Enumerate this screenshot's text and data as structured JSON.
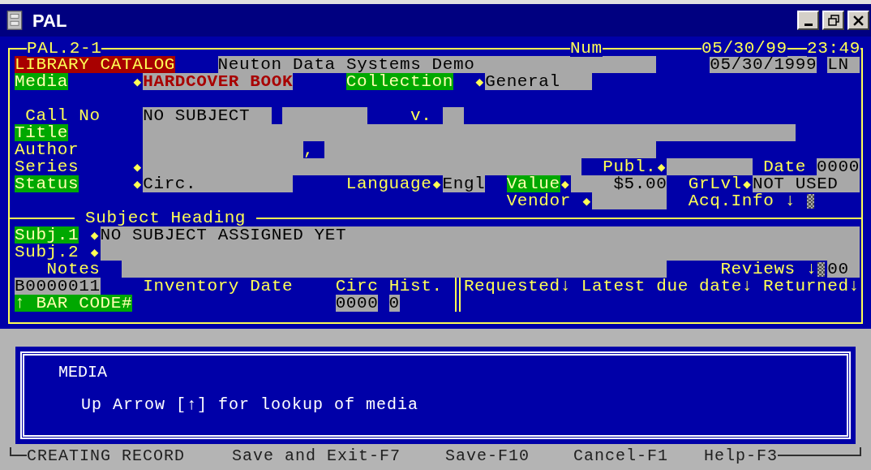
{
  "window": {
    "title": "PAL"
  },
  "frame": {
    "screen_id": "PAL.2-1",
    "keyboard_mode": "Num",
    "date": "05/30/99",
    "time": "23:49"
  },
  "header": {
    "module": "LIBRARY CATALOG",
    "organization": "Neuton Data Systems Demo",
    "record_date": "05/30/1999",
    "operator": "LN"
  },
  "fields": [
    {
      "kind": "field",
      "label": "Media",
      "highlighted": true,
      "marker": "◆",
      "value": "HARDCOVER BOOK",
      "focused": true
    },
    {
      "kind": "field",
      "label": "Collection",
      "highlighted": true,
      "marker": "◆",
      "value": "General",
      "focused": false
    },
    {
      "kind": "field",
      "label": "Call No",
      "highlighted": false,
      "value": "NO SUBJECT",
      "focused": false
    },
    {
      "kind": "field",
      "label": "v.",
      "highlighted": false
    },
    {
      "kind": "field",
      "label": "Title",
      "highlighted": true
    },
    {
      "kind": "field",
      "label": "Author",
      "highlighted": false,
      "separator": ","
    },
    {
      "kind": "field",
      "label": "Series",
      "highlighted": false,
      "marker": "◆"
    },
    {
      "kind": "field",
      "label": "Publ.",
      "highlighted": false,
      "marker": "◆"
    },
    {
      "kind": "field",
      "label": "Date",
      "highlighted": false,
      "value": "0000",
      "focused": false
    },
    {
      "kind": "field",
      "label": "Status",
      "highlighted": true,
      "marker": "◆",
      "value": "Circ.",
      "focused": false
    },
    {
      "kind": "field",
      "label": "Language",
      "highlighted": false,
      "marker": "◆",
      "value": "Engl",
      "focused": false
    },
    {
      "kind": "field",
      "label": "Value",
      "highlighted": true,
      "marker": "◆",
      "value": "$5.00",
      "focused": false
    },
    {
      "kind": "field",
      "label": "GrLvl",
      "highlighted": false,
      "marker": "◆",
      "value": "NOT USED",
      "focused": false
    },
    {
      "kind": "field",
      "label": "Vendor",
      "highlighted": false,
      "marker": "◆"
    },
    {
      "kind": "popup",
      "label": "Acq.Info ↓",
      "highlighted": false
    }
  ],
  "subject_heading": {
    "title": "Subject Heading",
    "fields": [
      {
        "kind": "field",
        "label": "Subj.1",
        "highlighted": true,
        "marker": "◆",
        "value": "NO SUBJECT ASSIGNED YET",
        "focused": false
      },
      {
        "kind": "field",
        "label": "Subj.2",
        "highlighted": false,
        "marker": "◆"
      },
      {
        "kind": "field",
        "label": "Notes",
        "highlighted": false
      },
      {
        "kind": "popup",
        "label": "Reviews ↓",
        "highlighted": false,
        "value": "00",
        "focused": false
      }
    ]
  },
  "barcode": {
    "value": "B0000011",
    "label": "↑ BAR CODE#",
    "highlighted": true
  },
  "inventory": {
    "label": "Inventory Date"
  },
  "circ_hist": {
    "label": "Circ Hist.",
    "values": [
      "0000",
      "0"
    ]
  },
  "circulation_columns": [
    "Requested↓",
    "Latest due date↓",
    "Returned↓"
  ],
  "help": {
    "title": "MEDIA",
    "text": "Up Arrow [↑] for lookup of media"
  },
  "status_bar": {
    "mode": "CREATING RECORD",
    "keys": [
      "Save and Exit-F7",
      "Save-F10",
      "Cancel-F1",
      "Help-F3"
    ]
  }
}
